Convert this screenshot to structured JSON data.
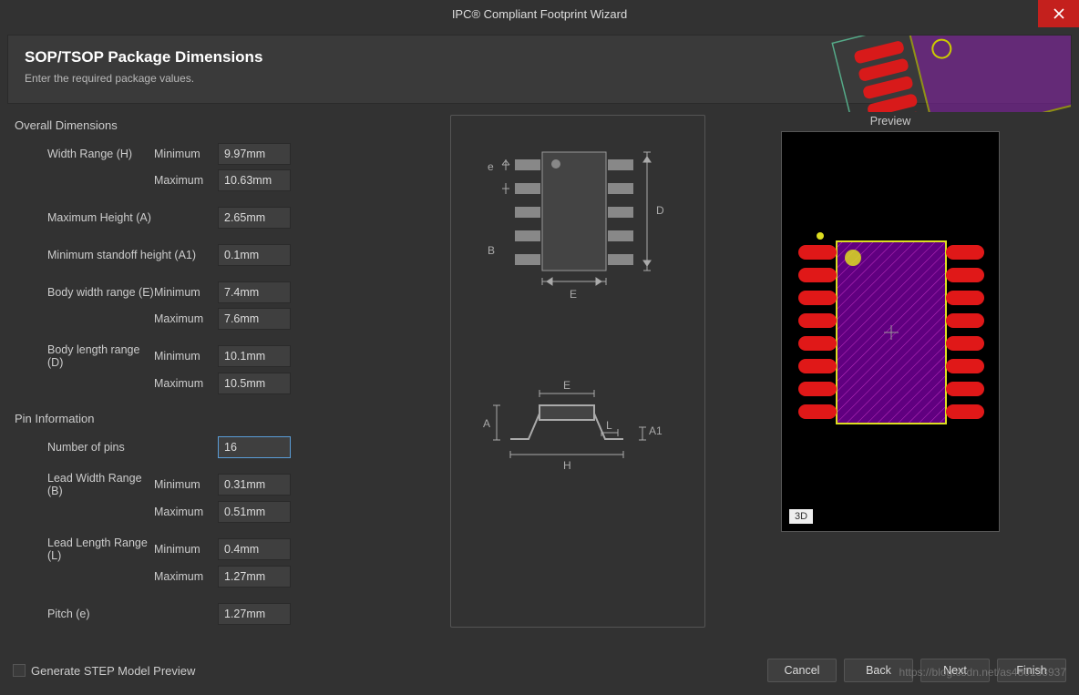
{
  "window": {
    "title": "IPC® Compliant Footprint Wizard"
  },
  "header": {
    "title": "SOP/TSOP Package Dimensions",
    "subtitle": "Enter the required package values."
  },
  "sections": {
    "overall": {
      "title": "Overall Dimensions",
      "widthRange": {
        "label": "Width Range (H)",
        "min": "9.97mm",
        "max": "10.63mm"
      },
      "maxHeight": {
        "label": "Maximum Height (A)",
        "value": "2.65mm"
      },
      "minStandoff": {
        "label": "Minimum standoff height (A1)",
        "value": "0.1mm"
      },
      "bodyWidth": {
        "label": "Body width range (E)",
        "min": "7.4mm",
        "max": "7.6mm"
      },
      "bodyLength": {
        "label": "Body length range (D)",
        "min": "10.1mm",
        "max": "10.5mm"
      }
    },
    "pin": {
      "title": "Pin Information",
      "numPins": {
        "label": "Number of pins",
        "value": "16"
      },
      "leadWidth": {
        "label": "Lead Width Range (B)",
        "min": "0.31mm",
        "max": "0.51mm"
      },
      "leadLength": {
        "label": "Lead Length Range (L)",
        "min": "0.4mm",
        "max": "1.27mm"
      },
      "pitch": {
        "label": "Pitch (e)",
        "value": "1.27mm"
      }
    }
  },
  "labels": {
    "minimum": "Minimum",
    "maximum": "Maximum"
  },
  "diagram": {
    "e": "e",
    "B": "B",
    "D": "D",
    "E": "E",
    "A": "A",
    "A1": "A1",
    "L": "L",
    "H": "H"
  },
  "preview": {
    "title": "Preview",
    "button3d": "3D"
  },
  "footer": {
    "checkbox": "Generate STEP Model Preview",
    "cancel": "Cancel",
    "back": "Back",
    "next": "Next",
    "finish": "Finish"
  },
  "watermark": "https://blog.csdn.net/as480133937"
}
